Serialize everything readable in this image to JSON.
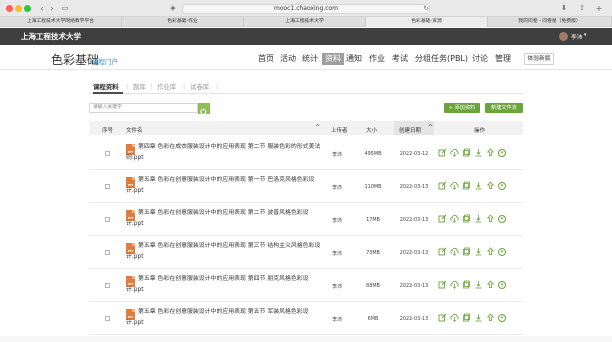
{
  "browser": {
    "url": "mooc1.chaoxing.com",
    "tabs": [
      {
        "label": "上海工程技术大学网络教学平台",
        "active": false
      },
      {
        "label": "色彩基础-作业",
        "active": false
      },
      {
        "label": "上海工程技术大学",
        "active": false
      },
      {
        "label": "色彩基础-资源",
        "active": true
      },
      {
        "label": "我的问卷 - 问卷星（免费版）",
        "active": false
      }
    ]
  },
  "header": {
    "school": "上海工程技术大学",
    "user": "李沛"
  },
  "course": {
    "title": "色彩基础",
    "portal": "课程门户",
    "nav": [
      "首页",
      "活动",
      "统计",
      "资料",
      "通知",
      "作业",
      "考试",
      "分组任务(PBL)",
      "讨论",
      "管理"
    ],
    "active_nav": "资料",
    "try_new": "体验新版"
  },
  "subtabs": [
    "课程资料",
    "题库",
    "作业库",
    "试卷库"
  ],
  "search": {
    "placeholder": "请输入关键字"
  },
  "buttons": {
    "add": "+ 添加资料",
    "new_folder": "新建文件夹"
  },
  "table": {
    "headers": {
      "no": "序号",
      "name": "文件名",
      "uploader": "上传者",
      "size": "大小",
      "date": "创建日期",
      "ops": "操作"
    },
    "rows": [
      {
        "name": "第四章 色彩在成衣服装设计中的应用表现 第二节 服装色彩的形式美法则.ppt",
        "uploader": "李沛",
        "size": "495MB",
        "date": "2022-03-12"
      },
      {
        "name": "第五章 色彩在创意服装设计中的应用表现 第一节 巴洛克风格色彩设计.ppt",
        "uploader": "李沛",
        "size": "110MB",
        "date": "2022-03-13"
      },
      {
        "name": "第五章 色彩在创意服装设计中的应用表现 第二节 波普风格色彩设计.ppt",
        "uploader": "李沛",
        "size": "17MB",
        "date": "2022-03-13"
      },
      {
        "name": "第五章 色彩在创意服装设计中的应用表现 第三节 结构主义风格色彩设计.ppt",
        "uploader": "李沛",
        "size": "73MB",
        "date": "2022-03-13"
      },
      {
        "name": "第五章 色彩在创意服装设计中的应用表现 第四节 朋克风格色彩设计.ppt",
        "uploader": "李沛",
        "size": "88MB",
        "date": "2022-03-13"
      },
      {
        "name": "第五章 色彩在创意服装设计中的应用表现 第五节 军装风格色彩设计.ppt",
        "uploader": "李沛",
        "size": "6MB",
        "date": "2022-03-13"
      }
    ],
    "file_type": "PPT"
  }
}
